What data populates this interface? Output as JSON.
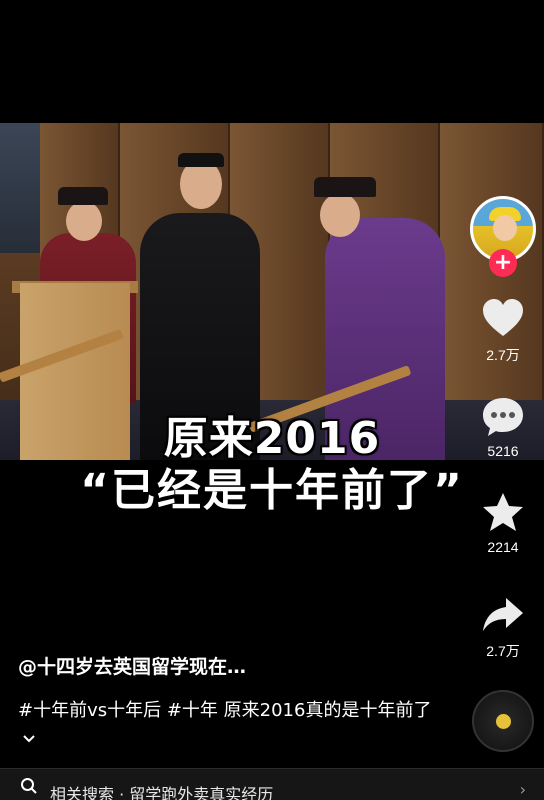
{
  "video": {
    "caption_line1": "原来2016",
    "caption_line2": "“已经是十年前了”"
  },
  "actions": {
    "follow_symbol": "+",
    "likes": "2.7万",
    "comments": "5216",
    "favorites": "2214",
    "shares": "2.7万",
    "accent_color": "#fe2c55"
  },
  "post": {
    "author": "@十四岁去英国留学现在…",
    "description": "#十年前vs十年后 #十年 原来2016真的是十年前了",
    "more_icon": "chevron-down-icon"
  },
  "related_search": {
    "label": "相关搜索 · 留学跑外卖真实经历",
    "chevron": "›"
  }
}
